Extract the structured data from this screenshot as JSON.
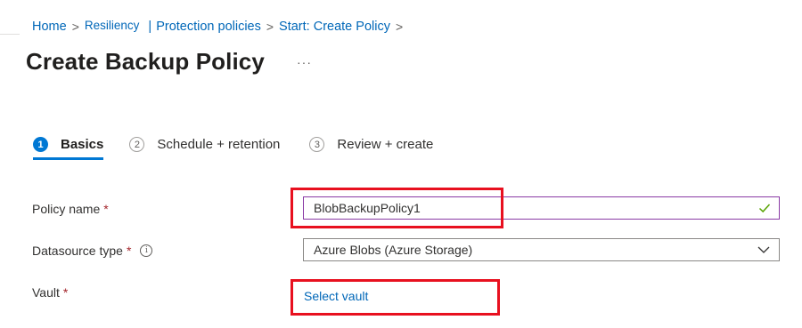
{
  "breadcrumb": {
    "home": "Home",
    "sep1": ">",
    "resiliency": "Resiliency",
    "pipe": "|",
    "protection_policies": "Protection policies",
    "sep2": ">",
    "start_create_policy": "Start: Create Policy",
    "sep3": ">"
  },
  "page": {
    "title": "Create Backup Policy",
    "more_label": "···"
  },
  "steps": [
    {
      "number": "1",
      "label": "Basics",
      "active": true
    },
    {
      "number": "2",
      "label": "Schedule + retention",
      "active": false
    },
    {
      "number": "3",
      "label": "Review + create",
      "active": false
    }
  ],
  "form": {
    "policy_name": {
      "label": "Policy name",
      "required_mark": "*",
      "value": "BlobBackupPolicy1",
      "valid": true
    },
    "datasource_type": {
      "label": "Datasource type",
      "required_mark": "*",
      "info_glyph": "i",
      "value": "Azure Blobs (Azure Storage)"
    },
    "vault": {
      "label": "Vault",
      "required_mark": "*",
      "link_text": "Select vault"
    }
  },
  "colors": {
    "link": "#0067b8",
    "accent": "#0078d4",
    "required": "#a4262c",
    "valid_check": "#57a300",
    "highlight": "#e8101f"
  }
}
